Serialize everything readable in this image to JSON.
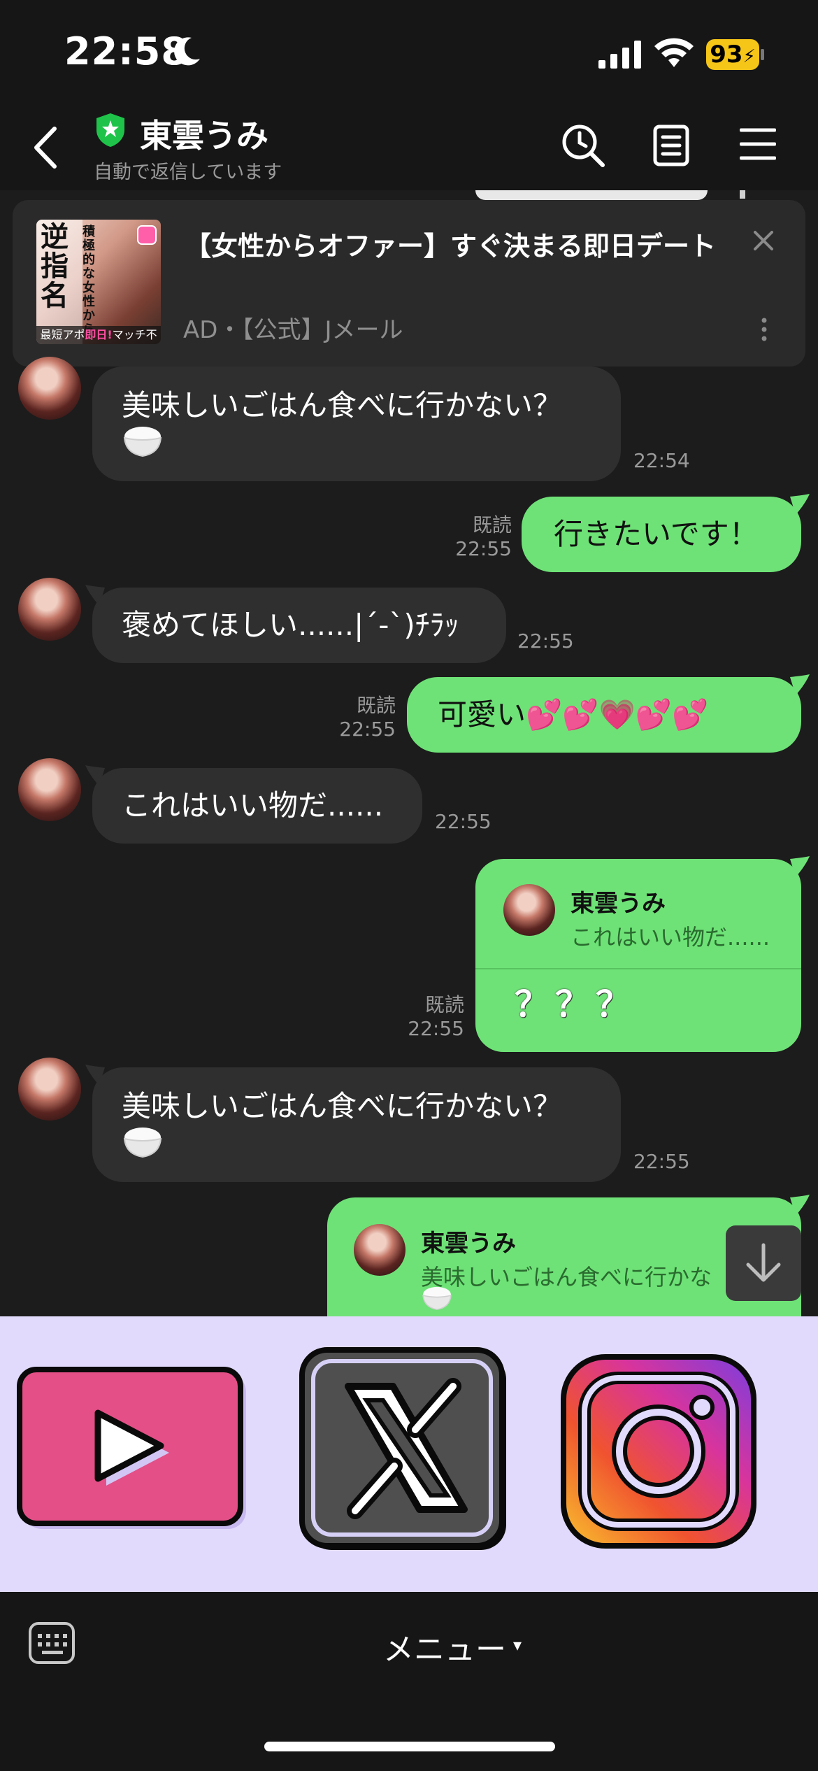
{
  "status_bar": {
    "time": "22:58",
    "battery": "93"
  },
  "header": {
    "title": "東雲うみ",
    "subtitle": "自動で返信しています"
  },
  "ad": {
    "title": "【女性からオファー】すぐ決まる即日デート",
    "sponsor": "AD・【公式】Jメール",
    "thumb_main": "逆指名",
    "thumb_side": "積極的な女性から",
    "thumb_foot_prefix": "最短アポ",
    "thumb_foot_highlight": "即日!",
    "thumb_foot_suffix": "マッチ不要!"
  },
  "messages": [
    {
      "dir": "in",
      "text": "美味しいごはん食べに行かない？",
      "icon": "rice-icon",
      "time": "22:54"
    },
    {
      "dir": "out",
      "text": "行きたいです！",
      "read": "既読",
      "time": "22:55"
    },
    {
      "dir": "in",
      "text": "褒めてほしい......|´-`)ﾁﾗｯ",
      "time": "22:55"
    },
    {
      "dir": "out",
      "text": "可愛い💕💕💗💕💕",
      "read": "既読",
      "time": "22:55"
    },
    {
      "dir": "in",
      "text": "これはいい物だ......",
      "time": "22:55"
    },
    {
      "dir": "out",
      "reply_name": "東雲うみ",
      "reply_text": "これはいい物だ......",
      "text": "？？？",
      "read": "既読",
      "time": "22:55"
    },
    {
      "dir": "in",
      "text": "美味しいごはん食べに行かない？",
      "icon": "rice-icon",
      "time": "22:55"
    },
    {
      "dir": "out",
      "reply_name": "東雲うみ",
      "reply_text": "美味しいごはん食べに行かな"
    }
  ],
  "rich_menu": {
    "items": [
      "youtube",
      "x",
      "instagram"
    ],
    "background": "#e1dafc"
  },
  "bottom_bar": {
    "menu_label": "メニュー",
    "caret": "▾"
  },
  "colors": {
    "outgoing_bubble": "#6ee277",
    "incoming_bubble": "#2f2f2f",
    "background": "#1c1c1c",
    "battery": "#f5c518"
  }
}
